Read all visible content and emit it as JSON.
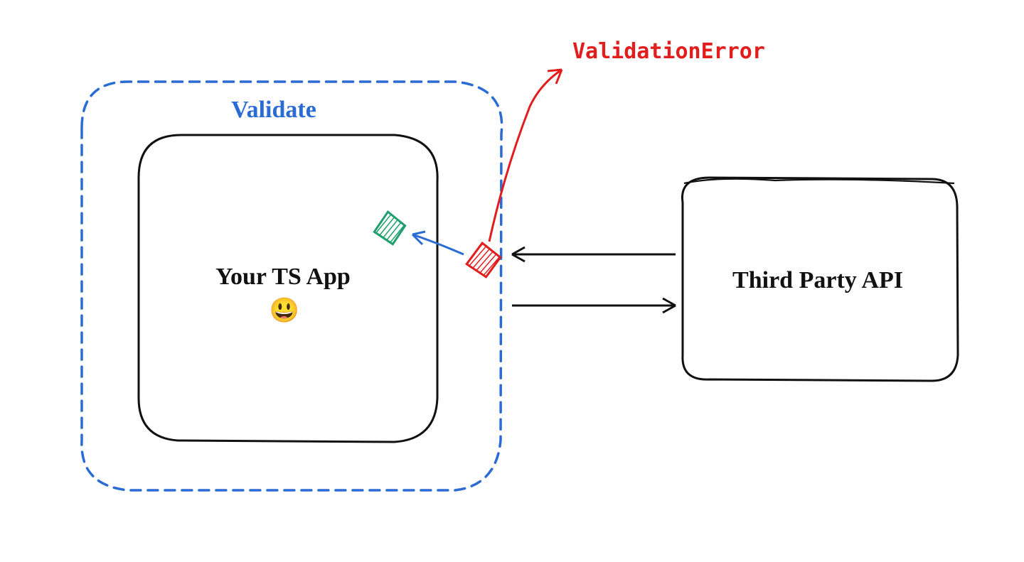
{
  "validate": {
    "label": "Validate",
    "color": "#2b6cd4"
  },
  "app": {
    "label": "Your TS App",
    "emoji": "😃"
  },
  "api": {
    "label": "Third Party API"
  },
  "error": {
    "label": "ValidationError",
    "color": "#e11d1d"
  },
  "shapes": {
    "valid": {
      "color": "#1f9e6e"
    },
    "invalid": {
      "color": "#e11d1d"
    }
  }
}
